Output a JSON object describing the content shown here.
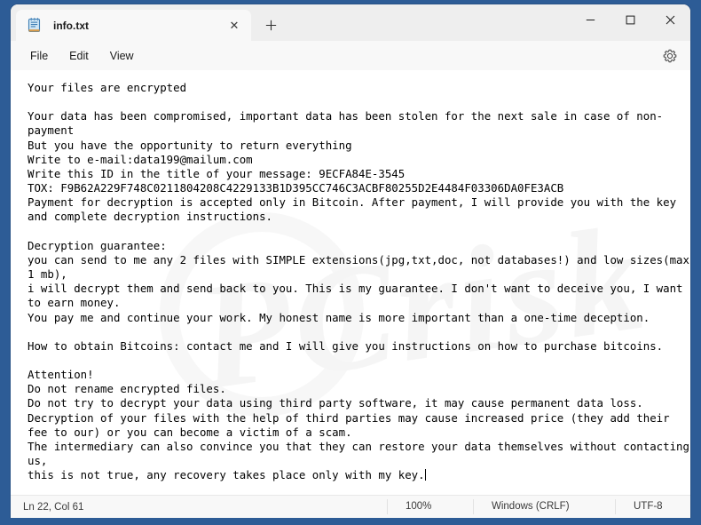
{
  "window": {
    "tab_title": "info.txt",
    "tab_icon": "notepad-icon",
    "close_tab_glyph": "✕",
    "new_tab_glyph": "＋",
    "minimize_glyph": "─",
    "maximize_glyph": "□",
    "close_glyph": "✕"
  },
  "menubar": {
    "items": [
      {
        "label": "File"
      },
      {
        "label": "Edit"
      },
      {
        "label": "View"
      }
    ],
    "settings_icon": "gear-icon"
  },
  "editor": {
    "content": "Your files are encrypted\n\nYour data has been compromised, important data has been stolen for the next sale in case of non-\npayment\nBut you have the opportunity to return everything\nWrite to e-mail:data199@mailum.com\nWrite this ID in the title of your message: 9ECFA84E-3545\nTOX: F9B62A229F748C0211804208C4229133B1D395CC746C3ACBF80255D2E4484F03306DA0FE3ACB\nPayment for decryption is accepted only in Bitcoin. After payment, I will provide you with the key\nand complete decryption instructions.\n\nDecryption guarantee:\nyou can send to me any 2 files with SIMPLE extensions(jpg,txt,doc, not databases!) and low sizes(max\n1 mb),\ni will decrypt them and send back to you. This is my guarantee. I don't want to deceive you, I want\nto earn money.\nYou pay me and continue your work. My honest name is more important than a one-time deception.\n\nHow to obtain Bitcoins: contact me and I will give you instructions on how to purchase bitcoins.\n\nAttention!\nDo not rename encrypted files.\nDo not try to decrypt your data using third party software, it may cause permanent data loss.\nDecryption of your files with the help of third parties may cause increased price (they add their\nfee to our) or you can become a victim of a scam.\nThe intermediary can also convince you that they can restore your data themselves without contacting\nus,\nthis is not true, any recovery takes place only with my key.",
    "watermark_text": "PCrisk"
  },
  "statusbar": {
    "cursor_position": "Ln 22, Col 61",
    "zoom": "100%",
    "line_ending": "Windows (CRLF)",
    "encoding": "UTF-8"
  },
  "colors": {
    "desktop": "#2d5c96",
    "window_bg": "#f8f8f8",
    "editor_bg": "#ffffff",
    "text": "#000000"
  }
}
